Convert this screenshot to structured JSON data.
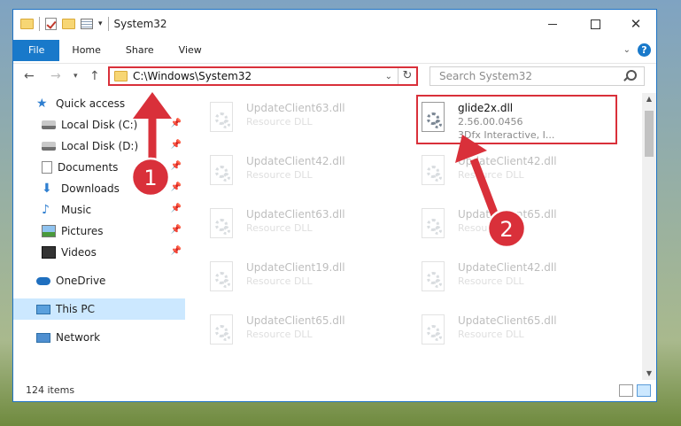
{
  "window": {
    "title": "System32"
  },
  "ribbon": {
    "tabs": [
      "File",
      "Home",
      "Share",
      "View"
    ]
  },
  "nav": {
    "address": "C:\\Windows\\System32",
    "search_placeholder": "Search System32"
  },
  "sidebar": {
    "items": [
      {
        "label": "Quick access",
        "icon": "star-icon",
        "pinned": false
      },
      {
        "label": "Local Disk (C:)",
        "icon": "drive-icon",
        "pinned": true
      },
      {
        "label": "Local Disk (D:)",
        "icon": "drive-icon",
        "pinned": true
      },
      {
        "label": "Documents",
        "icon": "documents-icon",
        "pinned": true
      },
      {
        "label": "Downloads",
        "icon": "downloads-icon",
        "pinned": true
      },
      {
        "label": "Music",
        "icon": "music-icon",
        "pinned": true
      },
      {
        "label": "Pictures",
        "icon": "pictures-icon",
        "pinned": true
      },
      {
        "label": "Videos",
        "icon": "videos-icon",
        "pinned": true
      },
      {
        "label": "OneDrive",
        "icon": "onedrive-icon",
        "pinned": false
      },
      {
        "label": "This PC",
        "icon": "this-pc-icon",
        "pinned": false,
        "selected": true
      },
      {
        "label": "Network",
        "icon": "network-icon",
        "pinned": false
      }
    ]
  },
  "files": {
    "highlighted": {
      "name": "glide2x.dll",
      "version": "2.56.00.0456",
      "company": "3Dfx Interactive, I..."
    },
    "left_column": [
      {
        "name": "UpdateClient63.dll",
        "type": "Resource DLL"
      },
      {
        "name": "UpdateClient42.dll",
        "type": "Resource DLL"
      },
      {
        "name": "UpdateClient63.dll",
        "type": "Resource DLL"
      },
      {
        "name": "UpdateClient19.dll",
        "type": "Resource DLL"
      },
      {
        "name": "UpdateClient65.dll",
        "type": "Resource DLL"
      }
    ],
    "right_column": [
      {
        "name": "UpdateClient42.dll",
        "type": "Resource DLL"
      },
      {
        "name": "UpdateClient65.dll",
        "type": "Resource DLL"
      },
      {
        "name": "UpdateClient42.dll",
        "type": "Resource DLL"
      },
      {
        "name": "UpdateClient65.dll",
        "type": "Resource DLL"
      }
    ]
  },
  "status": {
    "item_count": "124 items"
  },
  "annotations": {
    "step1": "1",
    "step2": "2",
    "color": "#d9303a"
  }
}
